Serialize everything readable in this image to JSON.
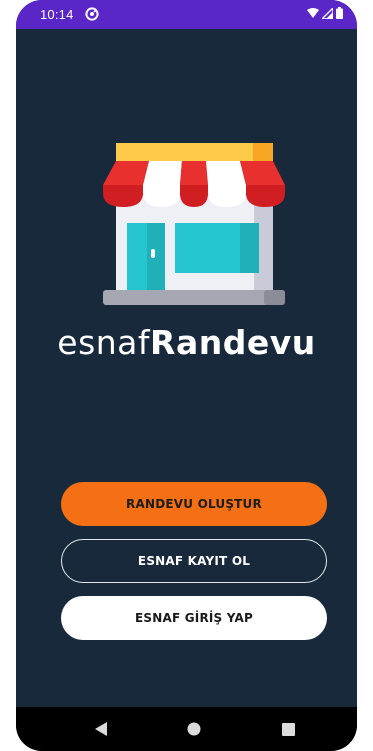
{
  "status_bar": {
    "time": "10:14",
    "app_icon": "circle-a-icon",
    "icons": [
      "wifi-icon",
      "signal-icon",
      "battery-icon"
    ]
  },
  "logo": {
    "icon": "storefront-icon",
    "name_light": "esnaf",
    "name_bold": "Randevu"
  },
  "buttons": {
    "create_appointment": "RANDEVU OLUŞTUR",
    "merchant_register": "ESNAF KAYIT OL",
    "merchant_login": "ESNAF GİRİŞ YAP"
  },
  "nav": {
    "back": "back-triangle-icon",
    "home": "home-circle-icon",
    "recents": "recents-square-icon"
  },
  "colors": {
    "background": "#17293a",
    "status_bar": "#5a26c7",
    "accent": "#f57014",
    "awning_red": "#e8302e",
    "awning_yellow": "#ffc94a",
    "window_cyan": "#26c6d0"
  }
}
